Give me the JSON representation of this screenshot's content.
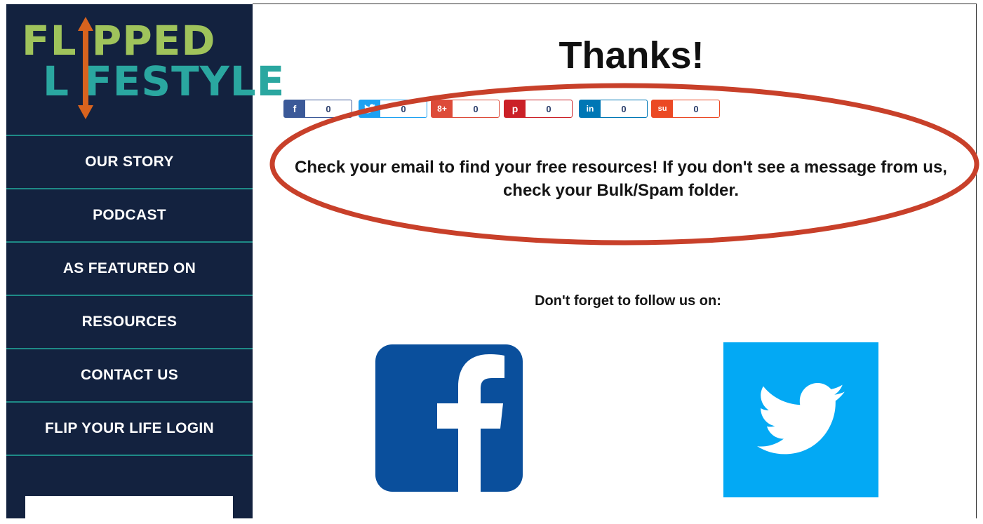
{
  "brand": {
    "logo_line1": "FL PPED",
    "logo_line2": "L FESTYLE",
    "primary_color": "#13223f",
    "green": "#9fc35b",
    "teal": "#2aa7a0",
    "orange": "#d8631e"
  },
  "nav": {
    "items": [
      {
        "label": "OUR STORY"
      },
      {
        "label": "PODCAST"
      },
      {
        "label": "AS FEATURED ON"
      },
      {
        "label": "RESOURCES"
      },
      {
        "label": "CONTACT US"
      },
      {
        "label": "FLIP YOUR LIFE LOGIN"
      }
    ]
  },
  "main": {
    "title": "Thanks!",
    "message": "Check your email to find your free resources! If you don't see a message from us, check your Bulk/Spam folder.",
    "follow_text": "Don't forget to follow us on:"
  },
  "share_buttons": [
    {
      "network": "facebook",
      "icon": "f",
      "count": "0",
      "color": "#3b5998"
    },
    {
      "network": "twitter",
      "icon": "twitter-bird-icon",
      "count": "0",
      "color": "#1da1f2"
    },
    {
      "network": "google-plus",
      "icon": "8+",
      "count": "0",
      "color": "#dd4b39"
    },
    {
      "network": "pinterest",
      "icon": "p",
      "count": "0",
      "color": "#cb2027"
    },
    {
      "network": "linkedin",
      "icon": "in",
      "count": "0",
      "color": "#0077b5"
    },
    {
      "network": "stumbleupon",
      "icon": "su",
      "count": "0",
      "color": "#eb4924"
    }
  ],
  "social_icons": [
    {
      "network": "facebook",
      "icon": "facebook-icon",
      "color": "#0a4f9c"
    },
    {
      "network": "twitter",
      "icon": "twitter-icon",
      "color": "#03a9f4"
    }
  ],
  "annotation": {
    "color": "#c8402a"
  }
}
